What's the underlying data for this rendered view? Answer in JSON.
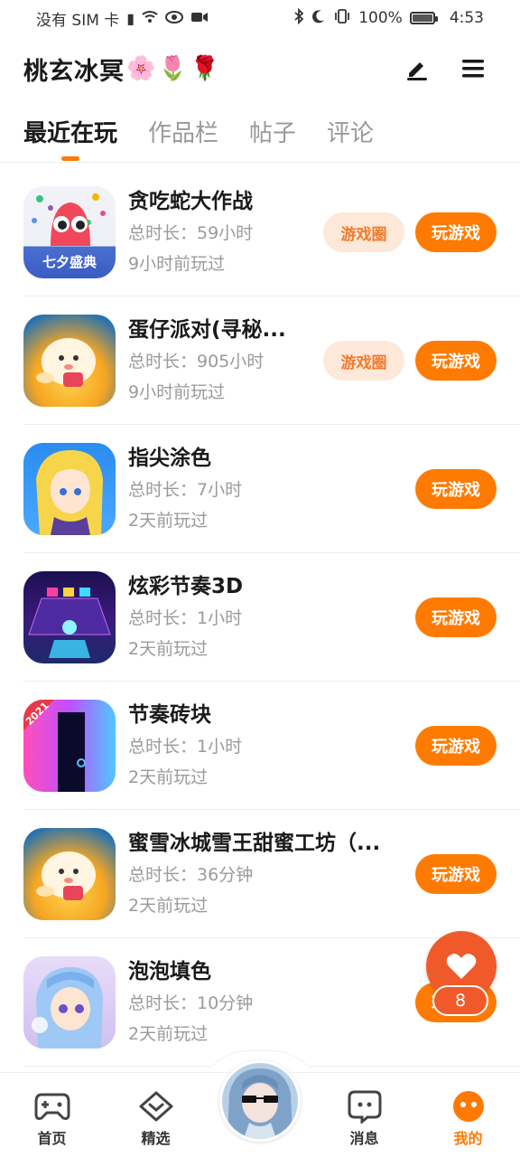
{
  "status_bar": {
    "carrier": "没有 SIM 卡",
    "battery": "100%",
    "battery_level": 1.0,
    "time": "4:53"
  },
  "header": {
    "profile_name": "桃玄冰冥",
    "emojis": [
      "🌸",
      "🌷",
      "🌹"
    ],
    "edit_icon": "pen-icon",
    "menu_icon": "hamburger-menu-icon"
  },
  "tabs": [
    {
      "label": "最近在玩",
      "active": true
    },
    {
      "label": "作品栏",
      "active": false
    },
    {
      "label": "帖子",
      "active": false
    },
    {
      "label": "评论",
      "active": false
    }
  ],
  "games": [
    {
      "title": "贪吃蛇大作战",
      "duration": "总时长：59小时",
      "last_played": "9小时前玩过",
      "circle_label": "游戏圈",
      "play_label": "玩游戏",
      "icon_badge": "七夕盛典"
    },
    {
      "title": "蛋仔派对(寻秘...",
      "duration": "总时长：905小时",
      "last_played": "9小时前玩过",
      "circle_label": "游戏圈",
      "play_label": "玩游戏"
    },
    {
      "title": "指尖涂色",
      "duration": "总时长：7小时",
      "last_played": "2天前玩过",
      "play_label": "玩游戏"
    },
    {
      "title": "炫彩节奏3D",
      "duration": "总时长：1小时",
      "last_played": "2天前玩过",
      "play_label": "玩游戏"
    },
    {
      "title": "节奏砖块",
      "duration": "总时长：1小时",
      "last_played": "2天前玩过",
      "play_label": "玩游戏",
      "icon_badge": "2021"
    },
    {
      "title": "蜜雪冰城雪王甜蜜工坊（...",
      "duration": "总时长：36分钟",
      "last_played": "2天前玩过",
      "play_label": "玩游戏"
    },
    {
      "title": "泡泡填色",
      "duration": "总时长：10分钟",
      "last_played": "2天前玩过",
      "play_label": "玩游戏"
    }
  ],
  "floating_like": {
    "count": "8",
    "icon": "heart-icon"
  },
  "bottom_nav": [
    {
      "label": "首页",
      "icon": "gamepad-icon"
    },
    {
      "label": "精选",
      "icon": "heart-diamond-icon"
    },
    {
      "label": "",
      "icon": "avatar"
    },
    {
      "label": "消息",
      "icon": "chat-bubble-icon"
    },
    {
      "label": "我的",
      "icon": "profile-face-icon",
      "active": true
    }
  ],
  "colors": {
    "accent": "#ff7a00",
    "circle_bg": "#fde8da",
    "circle_text": "#f47a2a",
    "like": "#f05a2a"
  }
}
